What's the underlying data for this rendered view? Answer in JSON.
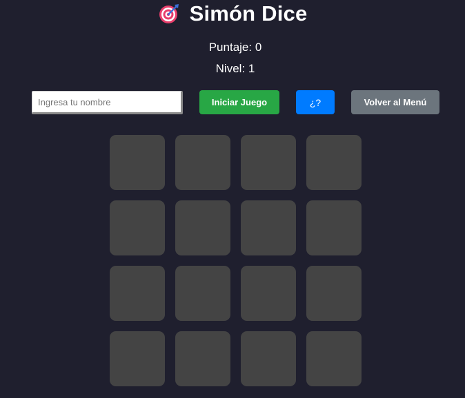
{
  "header": {
    "icon": "dart-target-icon",
    "title": "Simón Dice"
  },
  "stats": {
    "score": "Puntaje: 0",
    "level": "Nivel: 1"
  },
  "controls": {
    "name_placeholder": "Ingresa tu nombre",
    "name_value": "",
    "start_label": "Iniciar Juego",
    "help_label": "¿?",
    "menu_label": "Volver al Menú"
  },
  "board": {
    "rows": 4,
    "cols": 4,
    "cell_color": "#444444"
  },
  "colors": {
    "background": "#1f1f2e",
    "start_button": "#28a745",
    "help_button": "#007bff",
    "menu_button": "#6c757d"
  }
}
